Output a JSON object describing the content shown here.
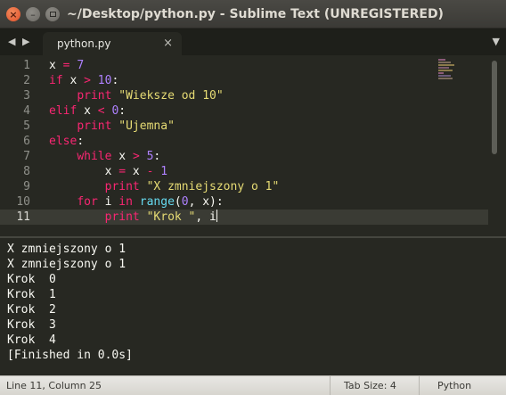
{
  "window": {
    "title": "~/Desktop/python.py - Sublime Text (UNREGISTERED)",
    "close_glyph": "×",
    "minimize_glyph": "–"
  },
  "tabbar": {
    "left_arrow": "◀",
    "right_arrow": "▶",
    "menu_arrow": "▼",
    "tabs": [
      {
        "label": "python.py",
        "close_glyph": "×"
      }
    ]
  },
  "editor": {
    "line_numbers": [
      "1",
      "2",
      "3",
      "4",
      "5",
      "6",
      "7",
      "8",
      "9",
      "10",
      "11"
    ],
    "active_line": 11,
    "lines": [
      [
        {
          "t": "x ",
          "c": "plain"
        },
        {
          "t": "=",
          "c": "keyword"
        },
        {
          "t": " ",
          "c": "plain"
        },
        {
          "t": "7",
          "c": "number"
        }
      ],
      [
        {
          "t": "if",
          "c": "keyword"
        },
        {
          "t": " x ",
          "c": "plain"
        },
        {
          "t": ">",
          "c": "keyword"
        },
        {
          "t": " ",
          "c": "plain"
        },
        {
          "t": "10",
          "c": "number"
        },
        {
          "t": ":",
          "c": "plain"
        }
      ],
      [
        {
          "t": "    ",
          "c": "plain"
        },
        {
          "t": "print",
          "c": "keyword"
        },
        {
          "t": " ",
          "c": "plain"
        },
        {
          "t": "\"Wieksze od 10\"",
          "c": "string"
        }
      ],
      [
        {
          "t": "elif",
          "c": "keyword"
        },
        {
          "t": " x ",
          "c": "plain"
        },
        {
          "t": "<",
          "c": "keyword"
        },
        {
          "t": " ",
          "c": "plain"
        },
        {
          "t": "0",
          "c": "number"
        },
        {
          "t": ":",
          "c": "plain"
        }
      ],
      [
        {
          "t": "    ",
          "c": "plain"
        },
        {
          "t": "print",
          "c": "keyword"
        },
        {
          "t": " ",
          "c": "plain"
        },
        {
          "t": "\"Ujemna\"",
          "c": "string"
        }
      ],
      [
        {
          "t": "else",
          "c": "keyword"
        },
        {
          "t": ":",
          "c": "plain"
        }
      ],
      [
        {
          "t": "    ",
          "c": "plain"
        },
        {
          "t": "while",
          "c": "keyword"
        },
        {
          "t": " x ",
          "c": "plain"
        },
        {
          "t": ">",
          "c": "keyword"
        },
        {
          "t": " ",
          "c": "plain"
        },
        {
          "t": "5",
          "c": "number"
        },
        {
          "t": ":",
          "c": "plain"
        }
      ],
      [
        {
          "t": "        x ",
          "c": "plain"
        },
        {
          "t": "=",
          "c": "keyword"
        },
        {
          "t": " x ",
          "c": "plain"
        },
        {
          "t": "-",
          "c": "keyword"
        },
        {
          "t": " ",
          "c": "plain"
        },
        {
          "t": "1",
          "c": "number"
        }
      ],
      [
        {
          "t": "        ",
          "c": "plain"
        },
        {
          "t": "print",
          "c": "keyword"
        },
        {
          "t": " ",
          "c": "plain"
        },
        {
          "t": "\"X zmniejszony o 1\"",
          "c": "string"
        }
      ],
      [
        {
          "t": "    ",
          "c": "plain"
        },
        {
          "t": "for",
          "c": "keyword"
        },
        {
          "t": " i ",
          "c": "plain"
        },
        {
          "t": "in",
          "c": "keyword"
        },
        {
          "t": " ",
          "c": "plain"
        },
        {
          "t": "range",
          "c": "builtin"
        },
        {
          "t": "(",
          "c": "plain"
        },
        {
          "t": "0",
          "c": "number"
        },
        {
          "t": ", x):",
          "c": "plain"
        }
      ],
      [
        {
          "t": "        ",
          "c": "plain"
        },
        {
          "t": "print",
          "c": "keyword"
        },
        {
          "t": " ",
          "c": "plain"
        },
        {
          "t": "\"Krok \"",
          "c": "string"
        },
        {
          "t": ", i",
          "c": "plain"
        }
      ]
    ],
    "colors": {
      "background": "#272822",
      "plain": "#f8f8f2",
      "keyword": "#f92672",
      "number": "#ae81ff",
      "string": "#e6db74",
      "builtin": "#66d9ef"
    }
  },
  "output": {
    "lines": [
      "X zmniejszony o 1",
      "X zmniejszony o 1",
      "Krok  0",
      "Krok  1",
      "Krok  2",
      "Krok  3",
      "Krok  4",
      "[Finished in 0.0s]"
    ]
  },
  "statusbar": {
    "position": "Line 11, Column 25",
    "tab_size": "Tab Size: 4",
    "syntax": "Python"
  }
}
